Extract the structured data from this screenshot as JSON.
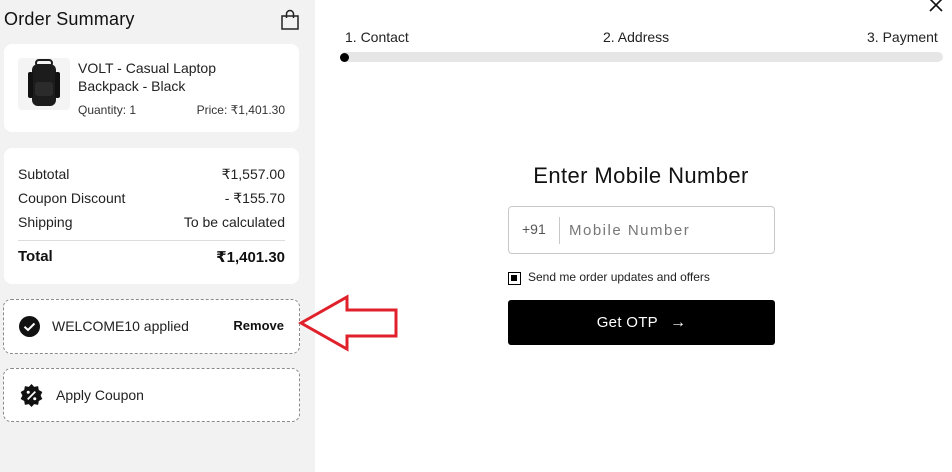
{
  "summary": {
    "title": "Order Summary",
    "product": {
      "name": "VOLT - Casual Laptop Backpack - Black",
      "quantity": "Quantity: 1",
      "price": "Price: ₹1,401.30"
    },
    "totals": {
      "subtotal_label": "Subtotal",
      "subtotal_value": "₹1,557.00",
      "discount_label": "Coupon Discount",
      "discount_value": "- ₹155.70",
      "shipping_label": "Shipping",
      "shipping_value": "To be calculated",
      "total_label": "Total",
      "total_value": "₹1,401.30"
    },
    "coupon": {
      "applied_text": "WELCOME10 applied",
      "remove_label": "Remove",
      "apply_label": "Apply Coupon"
    }
  },
  "steps": [
    "1. Contact",
    "2. Address",
    "3. Payment"
  ],
  "form": {
    "heading": "Enter Mobile Number",
    "country_code": "+91",
    "mobile_placeholder": "Mobile Number",
    "mobile_value": "",
    "consent_label": "Send me order updates and offers",
    "consent_checked": true,
    "submit_label": "Get OTP",
    "submit_arrow": "→"
  },
  "colors": {
    "accent": "#000000",
    "annotation_arrow": "#e0202a",
    "sidebar_bg": "#f2f2f2"
  },
  "icons": [
    "shopping-bag-icon",
    "close-icon",
    "check-circle-icon",
    "percent-badge-icon",
    "arrow-right-icon"
  ]
}
